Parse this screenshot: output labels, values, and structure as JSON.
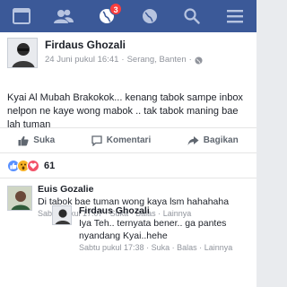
{
  "nav": {
    "notification_count": "3",
    "items": [
      "home",
      "friends",
      "notifications",
      "globe",
      "search",
      "menu"
    ]
  },
  "post": {
    "author": "Firdaus Ghozali",
    "date": "24 Juni pukul 16:41",
    "separator": "·",
    "location": "Serang, Banten",
    "location_separator": "·",
    "text": "Kyai Al Mubah Brakokok... kenang tabok sampe inbox nelpon ne kaye wong mabok .. tak tabok maning bae lah tuman"
  },
  "actions": {
    "like_label": "Suka",
    "comment_label": "Komentari",
    "share_label": "Bagikan"
  },
  "reactions": {
    "count": "61",
    "colors": {
      "like": "#5890ff",
      "wow": "#f7b125",
      "love": "#f25268"
    }
  },
  "comments": [
    {
      "author": "Euis Gozalie",
      "text": "Di tabok bae tuman wong kaya lsm hahahaha",
      "time": "Sabtu pukul 17:07",
      "like": "Suka",
      "reply": "Balas",
      "more": "Lainnya",
      "dot": "·"
    },
    {
      "author": "Firdaus Ghozali",
      "text": "Iya Teh.. ternyata bener.. ga pantes nyandang Kyai..hehe",
      "time": "Sabtu pukul 17:38",
      "like": "Suka",
      "reply": "Balas",
      "more": "Lainnya",
      "dot": "·"
    }
  ],
  "colors": {
    "brand": "#3b5998",
    "badge": "#fa3e3e"
  }
}
